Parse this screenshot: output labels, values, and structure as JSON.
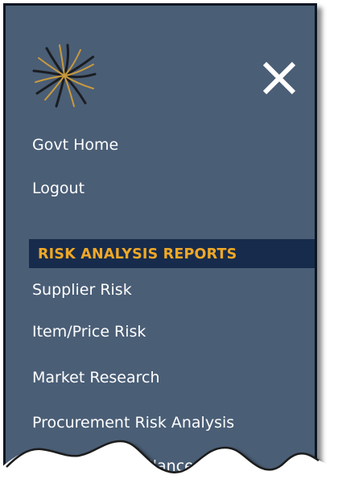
{
  "menu": {
    "links": [
      {
        "label": "Govt Home"
      },
      {
        "label": "Logout"
      }
    ],
    "section": {
      "title": "RISK ANALYSIS REPORTS",
      "items": [
        {
          "label": "Supplier Risk"
        },
        {
          "label": "Item/Price Risk"
        },
        {
          "label": "Market Research"
        },
        {
          "label": "Procurement Risk Analysis"
        },
        {
          "label": "Supplier Surveillance"
        }
      ]
    }
  },
  "icons": {
    "logo": "starburst-logo",
    "close": "close-icon"
  },
  "colors": {
    "panel_background": "#4a5e76",
    "section_header_background": "#172b4c",
    "section_header_text": "#f0a826",
    "link_text": "#ffffff"
  }
}
